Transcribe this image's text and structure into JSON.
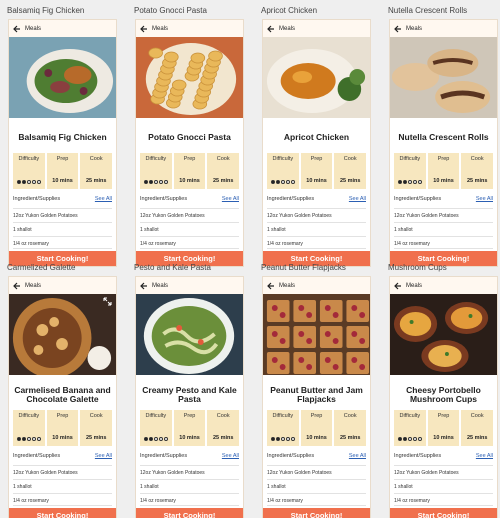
{
  "boards": [
    {
      "frame": "Balsamiq Fig Chicken",
      "nav": "Meals",
      "title": "Balsamiq Fig Chicken",
      "photo": "fig-chicken",
      "expand": false
    },
    {
      "frame": "Potato Gnocci Pasta",
      "nav": "Meals",
      "title": "Potato Gnocci Pasta",
      "photo": "gnocchi",
      "expand": false
    },
    {
      "frame": "Apricot Chicken",
      "nav": "Meals",
      "title": "Apricot Chicken",
      "photo": "apricot-chicken",
      "expand": false
    },
    {
      "frame": "Nutella Crescent Rolls",
      "nav": "Meals",
      "title": "Nutella Crescent Rolls",
      "photo": "crescent-rolls",
      "expand": false
    },
    {
      "frame": "Carmelized Galette",
      "nav": "Meals",
      "title": "Carmelised Banana and Chocolate Galette",
      "photo": "galette",
      "expand": true
    },
    {
      "frame": "Pesto and Kale Pasta",
      "nav": "Meals",
      "title": "Creamy Pesto and Kale Pasta",
      "photo": "pesto",
      "expand": false
    },
    {
      "frame": "Peanut Butter Flapjacks",
      "nav": "Meals",
      "title": "Peanut Butter and Jam Flapjacks",
      "photo": "flapjacks",
      "expand": false
    },
    {
      "frame": "Mushroom Cups",
      "nav": "Meals",
      "title": "Cheesy Portobello Mushroom Cups",
      "photo": "mushroom",
      "expand": false
    }
  ],
  "stats": {
    "difficulty_label": "Difficulty",
    "difficulty_level": 2,
    "difficulty_max": 5,
    "prep_label": "Prep",
    "prep_value": "10 mins",
    "cook_label": "Cook",
    "cook_value": "25 mins"
  },
  "ingredients_label": "Ingredient/Supplies",
  "see_all": "See All",
  "ingredients": [
    "12oz Yukon Golden Potatoes",
    "1 shallot",
    "1/4 oz rosemary"
  ],
  "cta": "Start Cooking!",
  "colors": {
    "accent": "#f0704d",
    "stat_bg": "#f7e7bf",
    "link": "#2b5fb3"
  }
}
